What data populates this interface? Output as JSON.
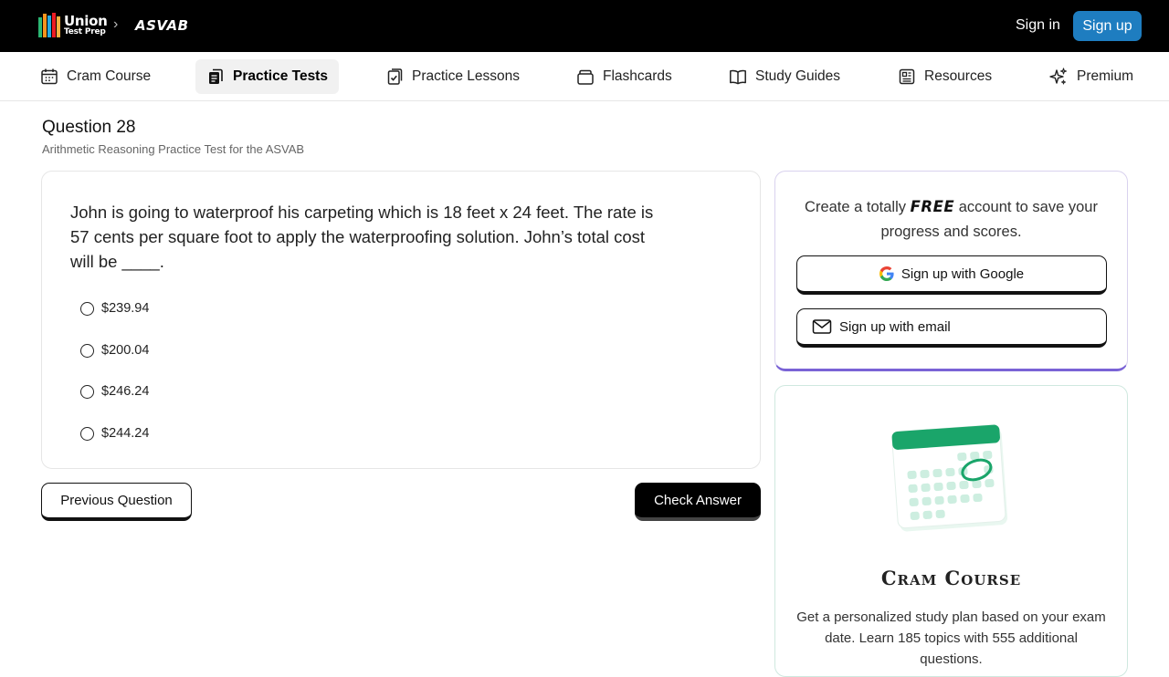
{
  "header": {
    "logo_line1": "Union",
    "logo_line2": "Test Prep",
    "breadcrumb_sep": "›",
    "exam": "ASVAB",
    "sign_in": "Sign in",
    "sign_up": "Sign up"
  },
  "nav": {
    "items": [
      {
        "label": "Cram Course"
      },
      {
        "label": "Practice Tests",
        "active": true
      },
      {
        "label": "Practice Lessons"
      },
      {
        "label": "Flashcards"
      },
      {
        "label": "Study Guides"
      },
      {
        "label": "Resources"
      },
      {
        "label": "Premium"
      }
    ]
  },
  "question": {
    "title": "Question 28",
    "subtitle": "Arithmetic Reasoning Practice Test for the ASVAB",
    "text": "John is going to waterproof his carpeting which is 18 feet x 24 feet. The rate is 57 cents per square foot to apply the waterproofing solution. John’s total cost will be ____.",
    "options": [
      "$239.94",
      "$200.04",
      "$246.24",
      "$244.24"
    ]
  },
  "actions": {
    "previous": "Previous Question",
    "check": "Check Answer"
  },
  "signup_card": {
    "msg_before": "Create a totally ",
    "msg_free": "FREE",
    "msg_after": " account to save your progress and scores.",
    "google": "Sign up with Google",
    "email": "Sign up with email"
  },
  "cram_card": {
    "title": "Cram Course",
    "description": "Get a personalized study plan based on your exam date. Learn 185 topics with 555 additional questions."
  },
  "colors": {
    "signup_button": "#1e7dc0",
    "calendar_green": "#1aa56a"
  }
}
